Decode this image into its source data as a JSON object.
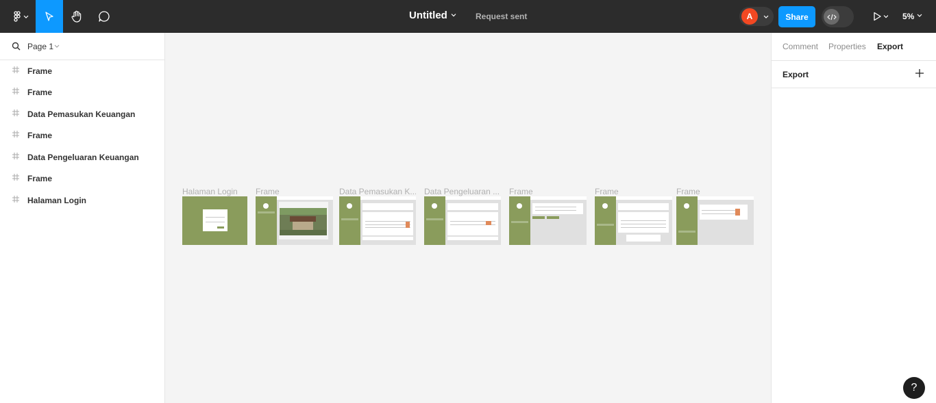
{
  "toolbar": {
    "title": "Untitled",
    "request_status": "Request sent",
    "avatar_initial": "A",
    "share_label": "Share",
    "zoom": "5%",
    "accent": "#0d99ff",
    "active_tool": "move"
  },
  "left_panel": {
    "page_label": "Page 1",
    "layers": [
      {
        "label": "Frame"
      },
      {
        "label": "Frame"
      },
      {
        "label": "Data Pemasukan Keuangan"
      },
      {
        "label": "Frame"
      },
      {
        "label": "Data Pengeluaran Keuangan"
      },
      {
        "label": "Frame"
      },
      {
        "label": "Halaman Login"
      }
    ]
  },
  "canvas": {
    "frames": [
      {
        "label": "Halaman Login"
      },
      {
        "label": "Frame"
      },
      {
        "label": "Data Pemasukan K..."
      },
      {
        "label": "Data Pengeluaran ..."
      },
      {
        "label": "Frame"
      },
      {
        "label": "Frame"
      },
      {
        "label": "Frame"
      }
    ]
  },
  "right_panel": {
    "tabs": [
      {
        "label": "Comment"
      },
      {
        "label": "Properties"
      },
      {
        "label": "Export"
      }
    ],
    "active_tab": "Export",
    "export_title": "Export"
  },
  "help_label": "?"
}
